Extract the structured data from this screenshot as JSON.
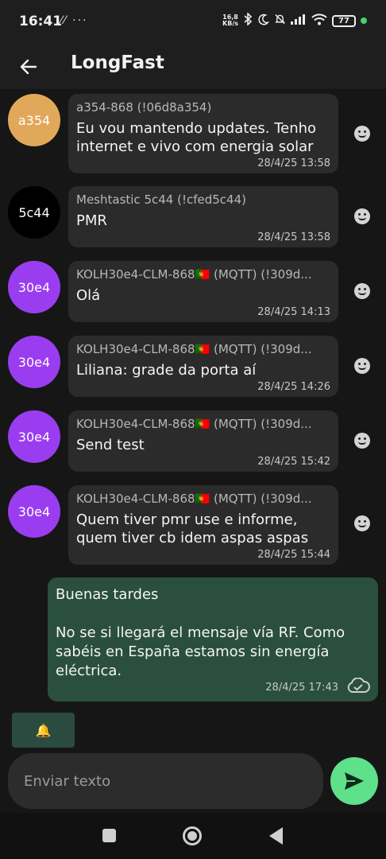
{
  "status_bar": {
    "time": "16:41",
    "left_icons": "⁄⁄ ···",
    "net_speed_value": "16,8",
    "net_speed_unit": "KB/s",
    "battery": "77"
  },
  "app_bar": {
    "title": "LongFast"
  },
  "messages": [
    {
      "avatar": "a354",
      "avatar_color": "#e2a85a",
      "sender": "a354-868 (!06d8a354)",
      "text": "Eu vou mantendo updates. Tenho internet e vivo com energia solar",
      "time": "28/4/25 13:58"
    },
    {
      "avatar": "5c44",
      "avatar_color": "#000000",
      "sender": "Meshtastic 5c44 (!cfed5c44)",
      "text": "PMR",
      "time": "28/4/25 13:58"
    },
    {
      "avatar": "30e4",
      "avatar_color": "#9a3df0",
      "sender": "KOLH30e4-CLM-868🇵🇹 (MQTT) (!309d...",
      "text": "Olá",
      "time": "28/4/25 14:13"
    },
    {
      "avatar": "30e4",
      "avatar_color": "#9a3df0",
      "sender": "KOLH30e4-CLM-868🇵🇹 (MQTT) (!309d...",
      "text": "Liliana: grade da porta aí",
      "time": "28/4/25 14:26"
    },
    {
      "avatar": "30e4",
      "avatar_color": "#9a3df0",
      "sender": "KOLH30e4-CLM-868🇵🇹 (MQTT) (!309d...",
      "text": "Send test",
      "time": "28/4/25 15:42"
    },
    {
      "avatar": "30e4",
      "avatar_color": "#9a3df0",
      "sender": "KOLH30e4-CLM-868🇵🇹 (MQTT) (!309d...",
      "text": "Quem tiver pmr use e informe, quem tiver cb idem aspas aspas",
      "time": "28/4/25 15:44"
    }
  ],
  "own_message": {
    "text": "Buenas tardes\n\nNo se si llegará el mensaje vía RF. Como sabéis en España estamos sin energía eléctrica.",
    "time": "28/4/25 17:43",
    "status_icon": "cloud-check-icon"
  },
  "quick_chip": {
    "emoji": "🔔"
  },
  "composer": {
    "placeholder": "Enviar texto"
  },
  "colors": {
    "accent": "#5fe08a",
    "own_bubble": "#2a4f3e",
    "incoming_bubble": "#2b2b2b"
  }
}
